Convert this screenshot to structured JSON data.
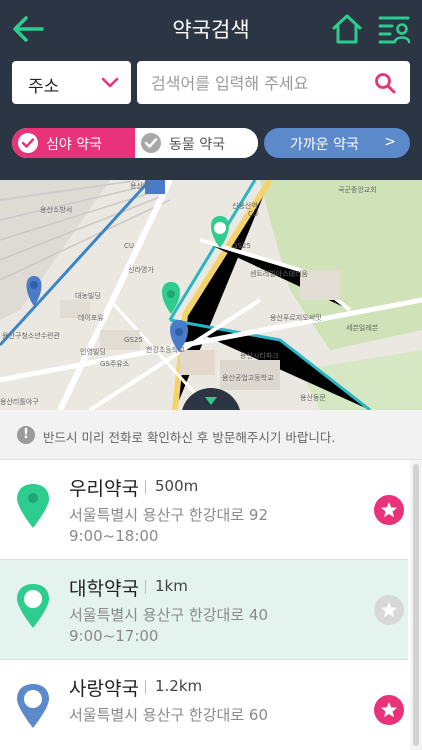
{
  "header": {
    "title": "약국검색",
    "back_icon": "arrow-left-icon",
    "home_icon": "home-icon",
    "menu_icon": "list-user-icon",
    "accent": "#2ecc8f"
  },
  "search": {
    "select_value": "주소",
    "placeholder": "검색어를 입력해 주세요",
    "value": ""
  },
  "filters": {
    "night": {
      "label": "심야 약국",
      "checked": true
    },
    "animal": {
      "label": "동물 약국",
      "checked": false
    },
    "nearby_label": "가까운 약국",
    "nearby_chevron": ">"
  },
  "notice": {
    "icon": "!",
    "text": "반드시 미리 전화로 확인하신 후 방문해주시기 바랍니다."
  },
  "pharmacies": [
    {
      "name": "우리약국",
      "distance": "500m",
      "address": "서울특별시 용산구 한강대로 92",
      "hours": "9:00~18:00",
      "pin_style": "green-filled",
      "favorite": true,
      "selected": false
    },
    {
      "name": "대학약국",
      "distance": "1km",
      "address": "서울특별시 용산구 한강대로 40",
      "hours": "9:00~17:00",
      "pin_style": "green-outline",
      "favorite": false,
      "selected": true
    },
    {
      "name": "사랑약국",
      "distance": "1.2km",
      "address": "서울특별시 용산구 한강대로 60",
      "hours": "",
      "pin_style": "blue-outline",
      "favorite": true,
      "selected": false
    }
  ],
  "map_labels": [
    "용산역",
    "신용산역",
    "CU",
    "GS25",
    "신라명가",
    "대농빌딩",
    "데이포유",
    "인영빌딩",
    "GS주유소",
    "한강초등학교",
    "용산공업고등학교",
    "센트레빌아스테리움",
    "용산푸르지오써밋",
    "세븐일레븐",
    "용산시티파크",
    "국군중앙교회",
    "목욕탕",
    "용산동문",
    "아모레퍼시픽",
    "한강대로",
    "신용산역",
    "용산구청소년수련관",
    "용산소방서",
    "용산리틀야구"
  ],
  "colors": {
    "header_bg": "#2b3544",
    "pink": "#e8337a",
    "green": "#2ecc8f",
    "blue": "#5b89c9",
    "star_off": "#d8d8d8"
  }
}
